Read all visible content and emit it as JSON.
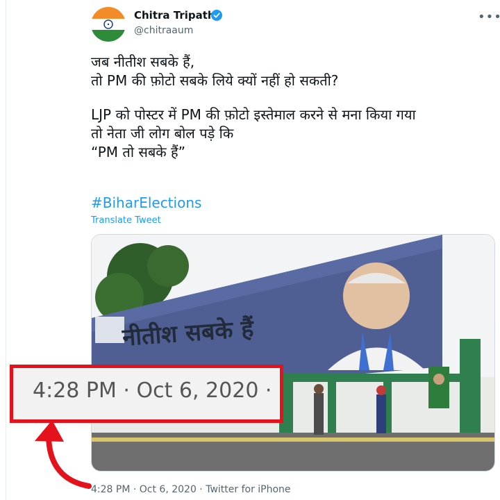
{
  "author": {
    "name": "Chitra Tripathi",
    "handle": "@chitraaum"
  },
  "tweet": {
    "lines": [
      "जब नीतीश सबके हैं,",
      "तो PM की फ़ोटो सबके लिये क्यों नहीं हो सकती?",
      "LJP को पोस्टर में PM की फ़ोटो इस्तेमाल करने से मना किया गया",
      "तो नेता जी लोग बोल पड़े कि",
      "“PM तो सबके हैं”"
    ],
    "hashtag": "#BiharElections",
    "translate_label": "Translate Tweet"
  },
  "media": {
    "banner_text": "नीतीश सबके हैं"
  },
  "highlight": {
    "zoom_text": "4:28 PM · Oct 6, 2020 ·"
  },
  "footer": {
    "timestamp_line": "4:28 PM · Oct 6, 2020 · Twitter for iPhone"
  },
  "colors": {
    "link": "#1d9bf0",
    "highlight": "#e3121b",
    "verified": "#1d9bf0"
  },
  "icons": [
    "verified-badge-icon",
    "more-options-icon",
    "red-arrow-icon"
  ]
}
